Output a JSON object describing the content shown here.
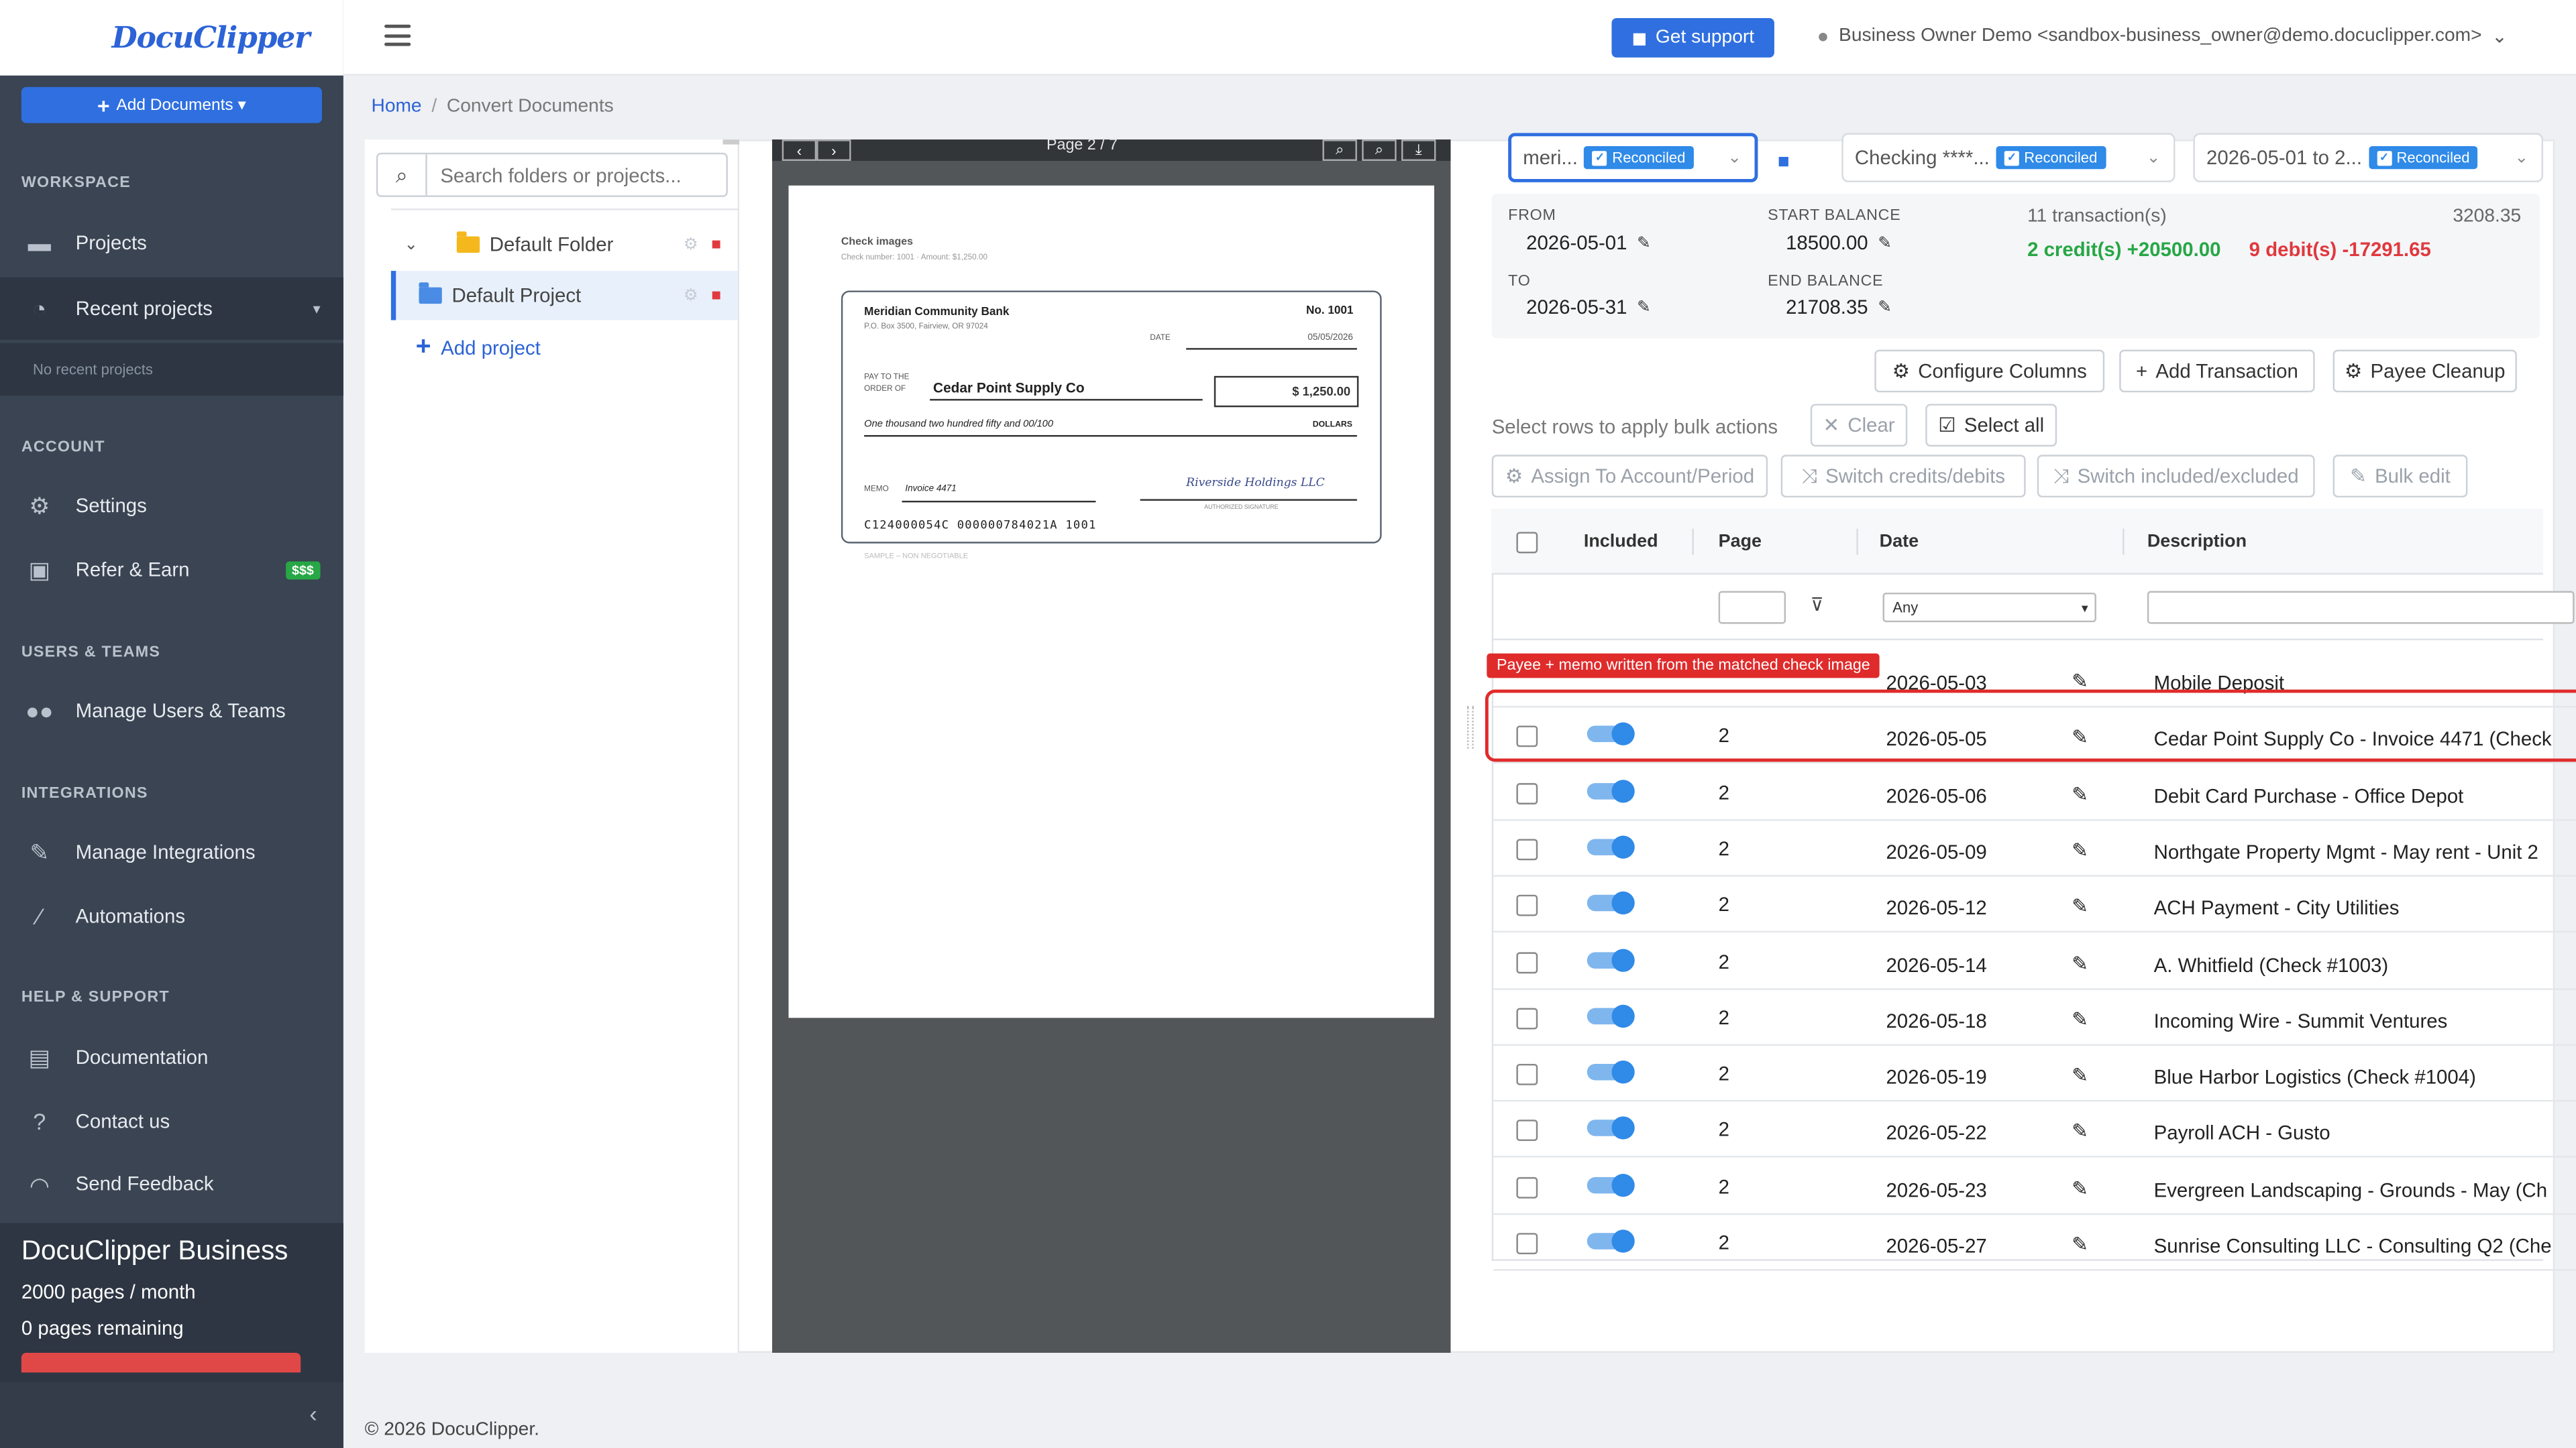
{
  "brand": {
    "logo": "DocuClipper"
  },
  "sidebar": {
    "add_documents": "Add Documents ▾",
    "sections": {
      "workspace": "WORKSPACE",
      "account": "ACCOUNT",
      "users": "USERS & TEAMS",
      "integrations": "INTEGRATIONS",
      "help": "HELP & SUPPORT"
    },
    "items": {
      "projects": "Projects",
      "recent": "Recent projects",
      "no_recent": "No recent projects",
      "settings": "Settings",
      "refer": "Refer & Earn",
      "refer_badge": "$$$",
      "manage_users": "Manage Users & Teams",
      "manage_integrations": "Manage Integrations",
      "automations": "Automations",
      "documentation": "Documentation",
      "contact": "Contact us",
      "feedback": "Send Feedback"
    },
    "plan": {
      "name": "DocuClipper Business",
      "pages": "2000 pages / month",
      "remaining": "0 pages remaining"
    }
  },
  "topbar": {
    "support": "Get support",
    "user": "Business Owner Demo <sandbox-business_owner@demo.docuclipper.com>"
  },
  "breadcrumb": {
    "home": "Home",
    "sep": "/",
    "current": "Convert Documents"
  },
  "folders": {
    "search_placeholder": "Search folders or projects...",
    "default_folder": "Default Folder",
    "default_project": "Default Project",
    "add_project": "Add project"
  },
  "viewer": {
    "page_label": "Page 2 / 7",
    "check_images_title": "Check images",
    "check_meta": "Check number: 1001 · Amount: $1,250.00",
    "check": {
      "bank": "Meridian Community Bank",
      "address": "P.O. Box 3500, Fairview, OR 97024",
      "number": "No. 1001",
      "date_label": "DATE",
      "date": "05/05/2026",
      "pay_label_1": "PAY TO THE",
      "pay_label_2": "ORDER OF",
      "payee": "Cedar Point Supply Co",
      "amount": "$ 1,250.00",
      "words": "One thousand two hundred fifty and 00/100",
      "dollars": "DOLLARS",
      "memo_label": "MEMO",
      "memo": "Invoice 4471",
      "signer": "Riverside Holdings LLC",
      "auth": "AUTHORIZED SIGNATURE",
      "micr": "C124000054C   000000784021A   1001",
      "sample": "SAMPLE – NON NEGOTIABLE"
    }
  },
  "filters": {
    "account": "meri...",
    "account_type": "Checking ****...",
    "period": "2026-05-01 to 2...",
    "reconciled": "Reconciled"
  },
  "summary": {
    "from_label": "FROM",
    "from": "2026-05-01",
    "to_label": "TO",
    "to": "2026-05-31",
    "start_label": "START BALANCE",
    "start": "18500.00",
    "end_label": "END BALANCE",
    "end": "21708.35",
    "count": "11 transaction(s)",
    "total": "3208.35",
    "credits": "2 credit(s) +20500.00",
    "debits": "9 debit(s) -17291.65"
  },
  "actions": {
    "configure": "Configure Columns",
    "add_txn": "Add Transaction",
    "payee_cleanup": "Payee Cleanup",
    "bulk_hint": "Select rows to apply bulk actions",
    "clear": "Clear",
    "select_all": "Select all",
    "assign": "Assign To Account/Period",
    "switch_cd": "Switch credits/debits",
    "switch_ie": "Switch included/excluded",
    "bulk_edit": "Bulk edit"
  },
  "table": {
    "headers": {
      "included": "Included",
      "page": "Page",
      "date": "Date",
      "description": "Description"
    },
    "date_filter": "Any",
    "tooltip": "Payee + memo written from the matched check image",
    "rows": [
      {
        "page": "",
        "date": "2026-05-03",
        "desc": "Mobile Deposit"
      },
      {
        "page": "2",
        "date": "2026-05-05",
        "desc": "Cedar Point Supply Co - Invoice 4471 (Check"
      },
      {
        "page": "2",
        "date": "2026-05-06",
        "desc": "Debit Card Purchase - Office Depot"
      },
      {
        "page": "2",
        "date": "2026-05-09",
        "desc": "Northgate Property Mgmt - May rent - Unit 2"
      },
      {
        "page": "2",
        "date": "2026-05-12",
        "desc": "ACH Payment - City Utilities"
      },
      {
        "page": "2",
        "date": "2026-05-14",
        "desc": "A. Whitfield (Check #1003)"
      },
      {
        "page": "2",
        "date": "2026-05-18",
        "desc": "Incoming Wire - Summit Ventures"
      },
      {
        "page": "2",
        "date": "2026-05-19",
        "desc": "Blue Harbor Logistics (Check #1004)"
      },
      {
        "page": "2",
        "date": "2026-05-22",
        "desc": "Payroll ACH - Gusto"
      },
      {
        "page": "2",
        "date": "2026-05-23",
        "desc": "Evergreen Landscaping - Grounds - May (Ch"
      },
      {
        "page": "2",
        "date": "2026-05-27",
        "desc": "Sunrise Consulting LLC - Consulting Q2 (Che"
      }
    ]
  },
  "footer": "© 2026 DocuClipper."
}
